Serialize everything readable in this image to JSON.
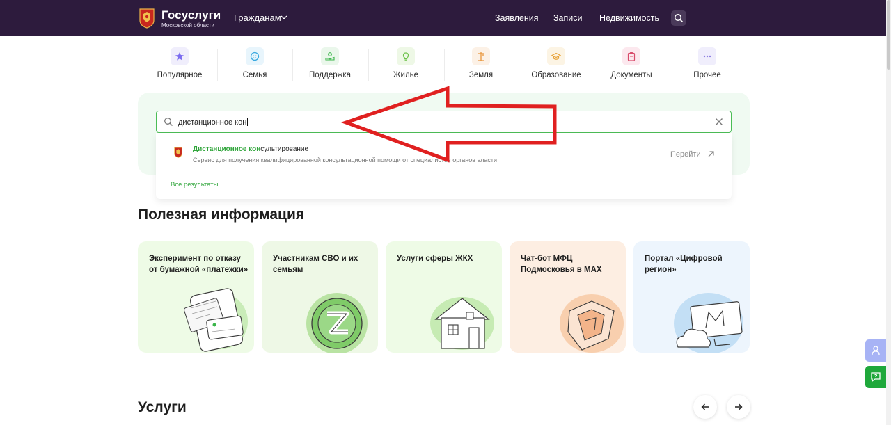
{
  "header": {
    "logo_title": "Госуслуги",
    "logo_subtitle": "Московской области",
    "audience_selector": "Гражданам",
    "nav": [
      {
        "label": "Заявления"
      },
      {
        "label": "Записи"
      },
      {
        "label": "Недвижимость"
      }
    ]
  },
  "categories": [
    {
      "label": "Популярное",
      "icon": "star-icon",
      "color": "#7b6cf0"
    },
    {
      "label": "Семья",
      "icon": "baby-icon",
      "color": "#3aa9e0"
    },
    {
      "label": "Поддержка",
      "icon": "hand-support-icon",
      "color": "#3ab54a"
    },
    {
      "label": "Жилье",
      "icon": "bulb-icon",
      "color": "#6cc24a"
    },
    {
      "label": "Земля",
      "icon": "crane-icon",
      "color": "#e8953a"
    },
    {
      "label": "Образование",
      "icon": "graduation-cap-icon",
      "color": "#e8a33a"
    },
    {
      "label": "Документы",
      "icon": "clipboard-icon",
      "color": "#d84a6a"
    },
    {
      "label": "Прочее",
      "icon": "dots-icon",
      "color": "#8a7ae0"
    }
  ],
  "search": {
    "value": "дистанционное кон",
    "result": {
      "title_highlight": "Дистанционное кон",
      "title_rest": "сультирование",
      "description": "Сервис для получения квалифицированной консультационной помощи от специалистов органов власти",
      "action": "Перейти"
    },
    "all_results": "Все результаты"
  },
  "useful_info": {
    "title": "Полезная информация",
    "cards": [
      {
        "title": "Эксперимент по отказу от бумажной «платежки»",
        "bg": "#eefbe6"
      },
      {
        "title": "Участникам СВО и их семьям",
        "bg": "#eef8e6"
      },
      {
        "title": "Услуги сферы ЖКХ",
        "bg": "#eefbe6"
      },
      {
        "title": "Чат-бот МФЦ Подмосковья в MAX",
        "bg": "#fdeee2"
      },
      {
        "title": "Портал «Цифровой регион»",
        "bg": "#edf5fd"
      }
    ]
  },
  "services": {
    "title": "Услуги"
  },
  "colors": {
    "header_bg": "#2d1b3d",
    "accent_green": "#2fa53a",
    "annotation_red": "#e02020"
  }
}
